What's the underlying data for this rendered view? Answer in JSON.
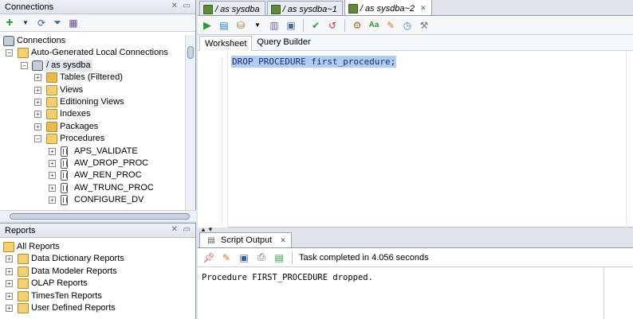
{
  "connections_panel": {
    "title": "Connections",
    "tree": [
      {
        "label": "Connections",
        "level": 0
      },
      {
        "label": "Auto-Generated Local Connections",
        "level": 1
      },
      {
        "label": "/ as sysdba",
        "level": 2
      },
      {
        "label": "Tables (Filtered)",
        "level": 3
      },
      {
        "label": "Views",
        "level": 3
      },
      {
        "label": "Editioning Views",
        "level": 3
      },
      {
        "label": "Indexes",
        "level": 3
      },
      {
        "label": "Packages",
        "level": 3
      },
      {
        "label": "Procedures",
        "level": 3
      },
      {
        "label": "APS_VALIDATE",
        "level": 4
      },
      {
        "label": "AW_DROP_PROC",
        "level": 4
      },
      {
        "label": "AW_REN_PROC",
        "level": 4
      },
      {
        "label": "AW_TRUNC_PROC",
        "level": 4
      },
      {
        "label": "CONFIGURE_DV",
        "level": 4
      }
    ]
  },
  "reports_panel": {
    "title": "Reports",
    "tree": [
      {
        "label": "All Reports"
      },
      {
        "label": "Data Dictionary Reports"
      },
      {
        "label": "Data Modeler Reports"
      },
      {
        "label": "OLAP Reports"
      },
      {
        "label": "TimesTen Reports"
      },
      {
        "label": "User Defined Reports"
      }
    ]
  },
  "editor": {
    "tabs": [
      {
        "label": "/ as sysdba"
      },
      {
        "label": "/ as sysdba~1"
      },
      {
        "label": "/ as sysdba~2"
      }
    ],
    "subtabs": {
      "worksheet": "Worksheet",
      "query_builder": "Query Builder"
    },
    "code": "DROP PROCEDURE first_procedure;"
  },
  "script_output": {
    "tab_label": "Script Output",
    "status": "Task completed in 4.056 seconds",
    "output_line": "Procedure FIRST_PROCEDURE dropped."
  },
  "colors": {
    "selection": "#aecdf0",
    "code_text": "#1c2a78",
    "run_green": "#2e9b2e"
  }
}
